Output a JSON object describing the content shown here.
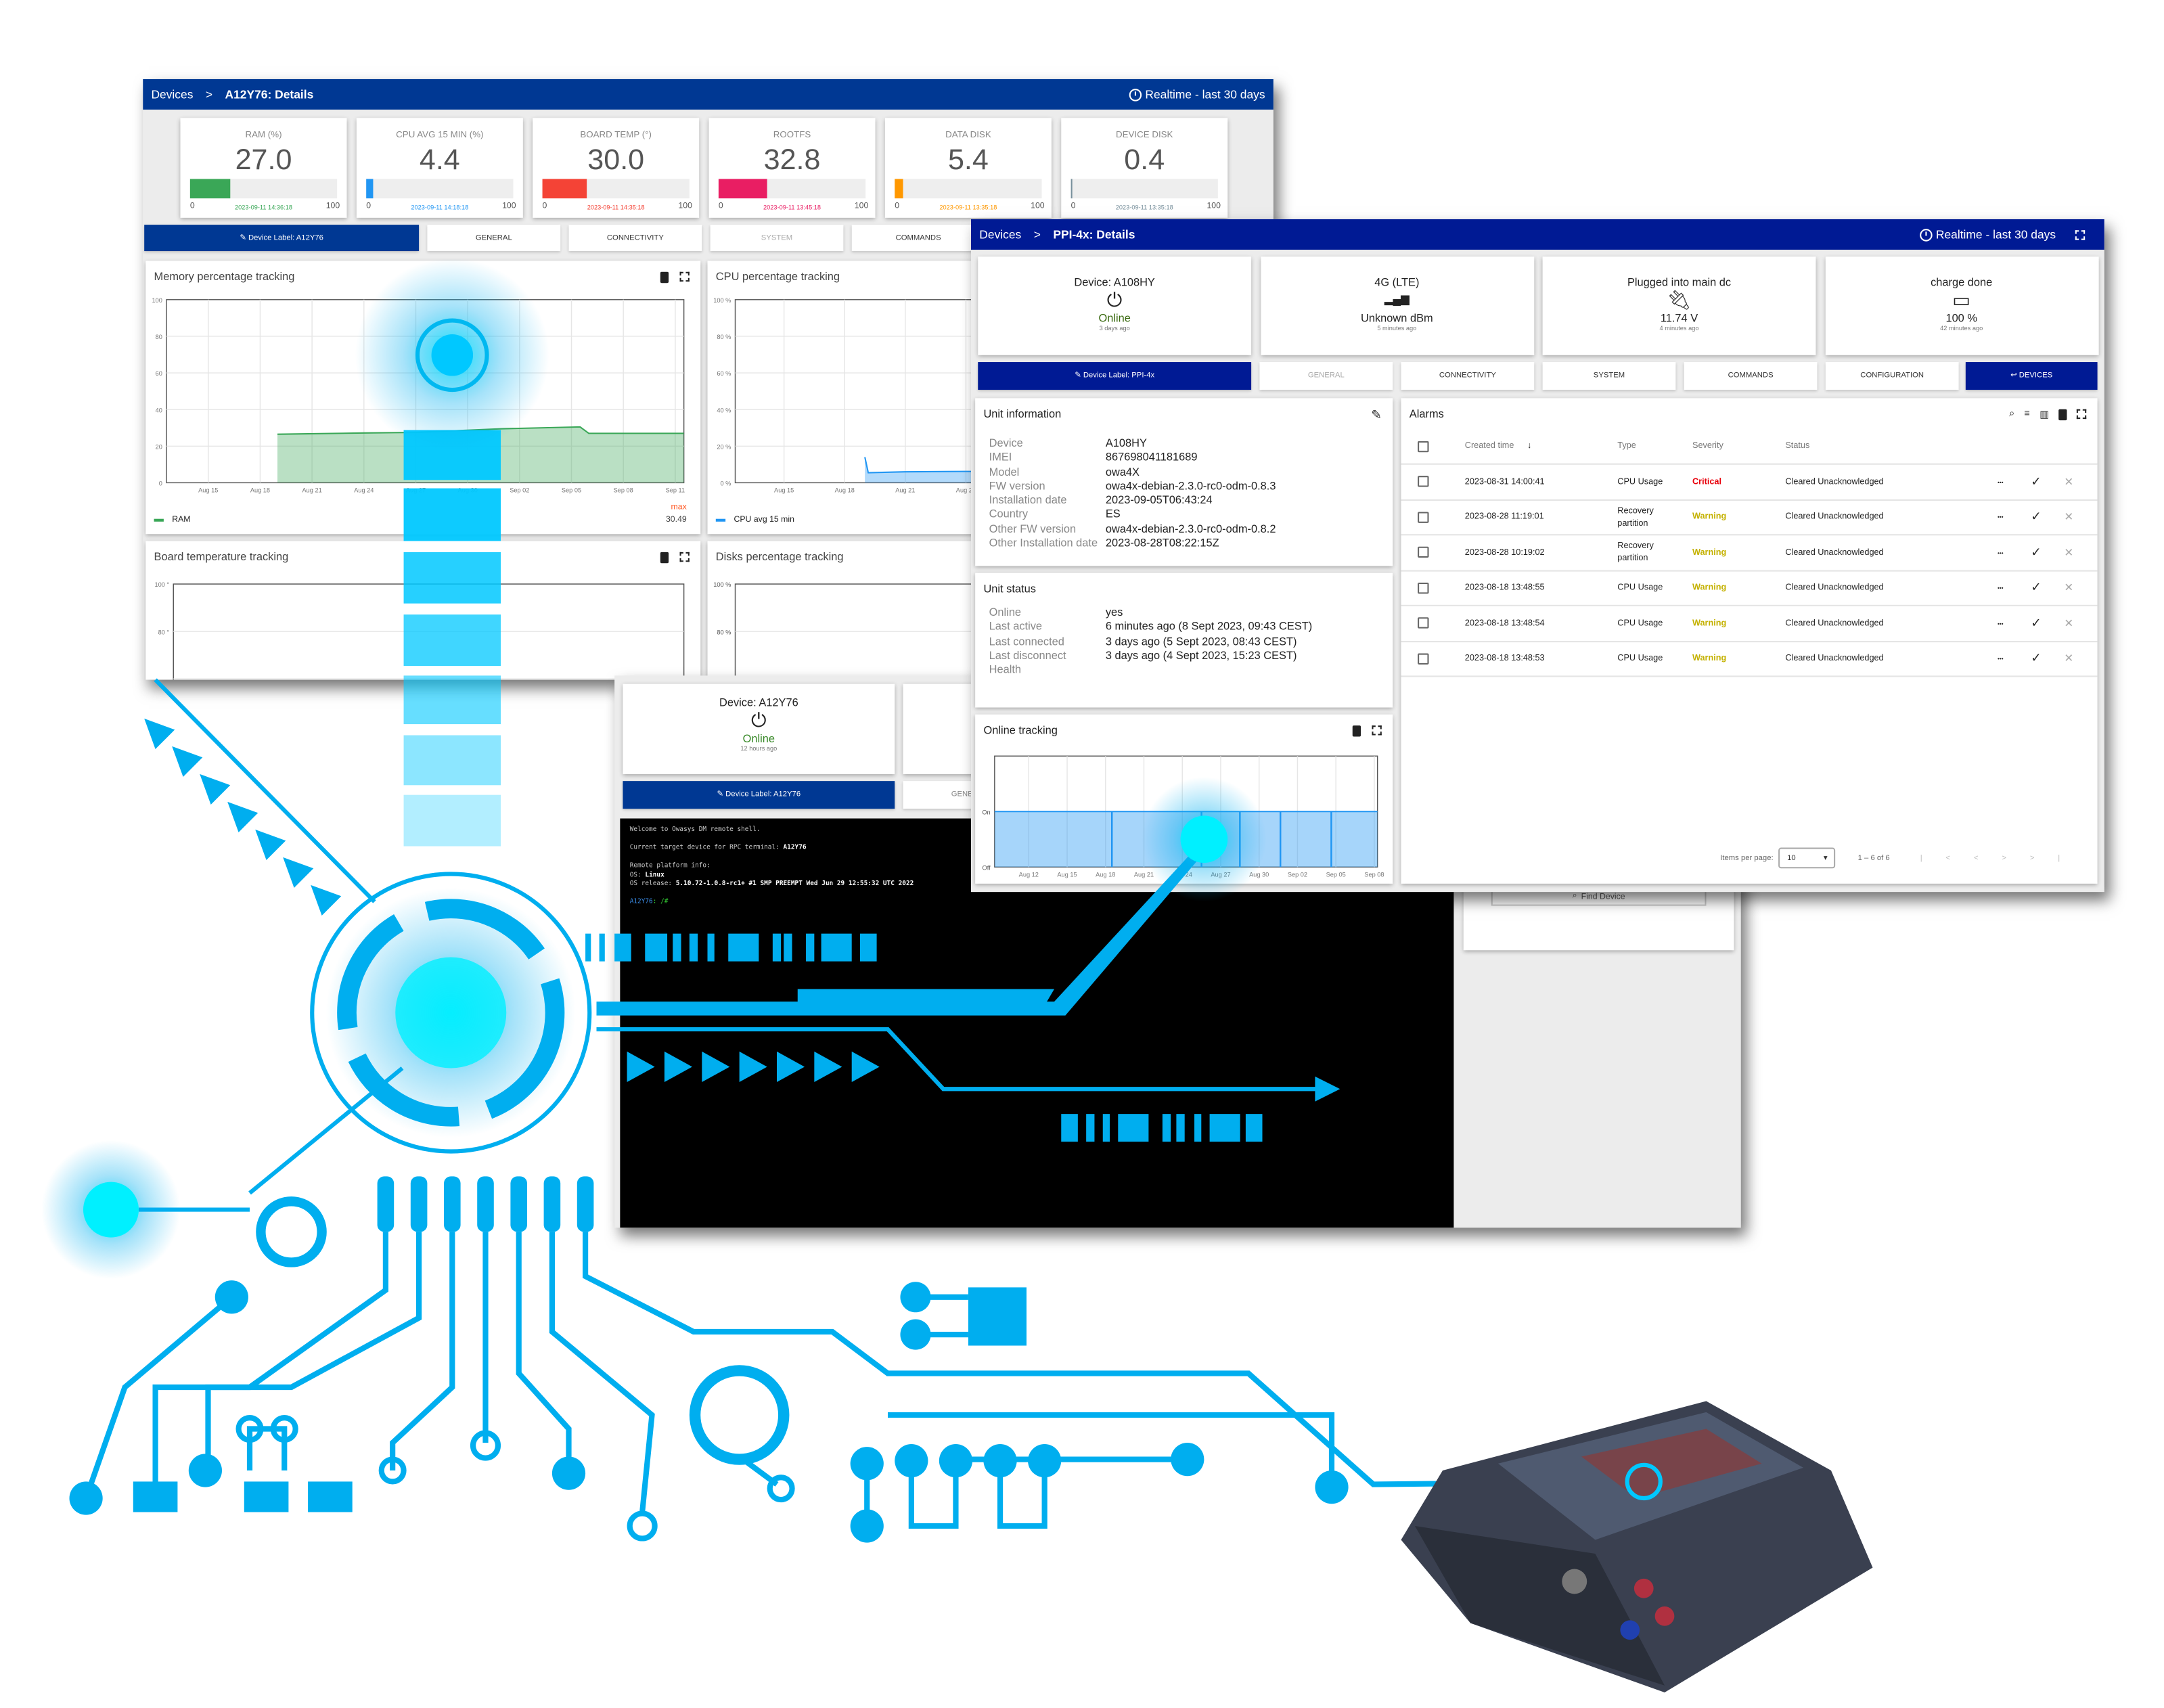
{
  "back_window": {
    "breadcrumb_root": "Devices",
    "separator": ">",
    "title": "A12Y76: Details",
    "realtime": "Realtime - last 30 days",
    "kpis": [
      {
        "label": "RAM (%)",
        "value": "27.0",
        "min": "0",
        "max": "100",
        "timestamp": "2023-09-11 14:36:18",
        "color": "#3aa757",
        "percent": 27
      },
      {
        "label": "CPU AVG 15 MIN (%)",
        "value": "4.4",
        "min": "0",
        "max": "100",
        "timestamp": "2023-09-11 14:18:18",
        "color": "#2196f3",
        "percent": 4.4
      },
      {
        "label": "BOARD TEMP (°)",
        "value": "30.0",
        "min": "0",
        "max": "100",
        "timestamp": "2023-09-11 14:35:18",
        "color": "#f44336",
        "percent": 30
      },
      {
        "label": "ROOTFS",
        "value": "32.8",
        "min": "0",
        "max": "100",
        "timestamp": "2023-09-11 13:45:18",
        "color": "#e91e63",
        "percent": 32.8
      },
      {
        "label": "DATA DISK",
        "value": "5.4",
        "min": "0",
        "max": "100",
        "timestamp": "2023-09-11 13:35:18",
        "color": "#ff9800",
        "percent": 5.4
      },
      {
        "label": "DEVICE DISK",
        "value": "0.4",
        "min": "0",
        "max": "100",
        "timestamp": "2023-09-11 13:35:18",
        "color": "#78909c",
        "percent": 0.4
      }
    ],
    "tabs": {
      "device_label": "Device Label: A12Y76",
      "general": "GENERAL",
      "connectivity": "CONNECTIVITY",
      "system": "SYSTEM",
      "commands": "COMMANDS"
    },
    "memory_chart": {
      "title": "Memory percentage tracking",
      "yticks": [
        "0",
        "20",
        "40",
        "60",
        "80",
        "100"
      ],
      "xticks": [
        "Aug 15",
        "Aug 18",
        "Aug 21",
        "Aug 24",
        "Aug 27",
        "Aug 30",
        "Sep 02",
        "Sep 05",
        "Sep 08",
        "Sep 11"
      ],
      "xlim": [
        "2023-08-12T14:00",
        "2023-09-11T12:00"
      ],
      "ylim": [
        0,
        100
      ],
      "color": "#3aa757",
      "series": [
        [
          "2023-08-19T00:00",
          26.5
        ],
        [
          "2023-08-24T00:00",
          27.2
        ],
        [
          "2023-08-27T00:00",
          27.5
        ],
        [
          "2023-09-01T00:00",
          29.5
        ],
        [
          "2023-09-05T12:00",
          30.5
        ],
        [
          "2023-09-06T00:00",
          27
        ],
        [
          "2023-09-11T12:00",
          27
        ]
      ],
      "legend": "RAM",
      "max_label": "max",
      "max_value": "30.49"
    },
    "cpu_chart": {
      "title": "CPU percentage tracking",
      "yticks": [
        "0 %",
        "20 %",
        "40 %",
        "60 %",
        "80 %",
        "100 %"
      ],
      "xticks": [
        "Aug 15",
        "Aug 18",
        "Aug 21",
        "Aug 24",
        "Aug 27"
      ],
      "xlim": [
        "2023-08-12T14:00",
        "2023-08-27T00:00"
      ],
      "ylim": [
        0,
        100
      ],
      "color": "#2196f3",
      "series": [
        [
          "2023-08-19T00:00",
          14
        ],
        [
          "2023-08-19T04:00",
          5.5
        ],
        [
          "2023-08-21T00:00",
          6
        ],
        [
          "2023-08-24T00:00",
          6.2
        ],
        [
          "2023-08-27T00:00",
          6
        ]
      ],
      "legend": "CPU avg 15 min"
    },
    "temp_chart": {
      "title": "Board temperature tracking",
      "yticks": [
        "80 °",
        "100 °"
      ]
    },
    "disks_chart": {
      "title": "Disks percentage tracking",
      "yticks": [
        "80 %",
        "100 %"
      ]
    }
  },
  "middle_window": {
    "device_card": {
      "title": "Device: A12Y76",
      "status": "Online",
      "since": "12 hours ago"
    },
    "tabs": {
      "device_label": "Device Label: A12Y76",
      "general": "GENERAL"
    },
    "terminal": {
      "welcome": "Welcome to Owasys DM remote shell.",
      "target_label": "Current target device for RPC terminal: ",
      "target": "A12Y76",
      "platform_label": "Remote platform info:",
      "os_label": "OS: ",
      "os": "Linux",
      "release_label": "OS release: ",
      "release": "5.10.72-1.0.8-rc1+ #1 SMP PREEMPT Wed Jun 29 12:55:32 UTC 2022",
      "prompt_host": "A12Y76",
      "prompt_path": ": /#"
    },
    "find_device": "Find Device"
  },
  "front_window": {
    "breadcrumb_root": "Devices",
    "separator": ">",
    "title": "PPI-4x: Details",
    "realtime": "Realtime - last 30 days",
    "status_cards": [
      {
        "title": "Device: A108HY",
        "icon": "power-icon",
        "value": "Online",
        "since": "3 days ago"
      },
      {
        "title": "4G (LTE)",
        "icon": "signal-icon",
        "value": "Unknown dBm",
        "since": "5 minutes ago"
      },
      {
        "title": "Plugged into main dc",
        "icon": "plug-icon",
        "value": "11.74 V",
        "since": "4 minutes ago"
      },
      {
        "title": "charge done",
        "icon": "battery-icon",
        "value": "100 %",
        "since": "42 minutes ago"
      }
    ],
    "tabs": {
      "device_label": "Device Label: PPI-4x",
      "general": "GENERAL",
      "connectivity": "CONNECTIVITY",
      "system": "SYSTEM",
      "commands": "COMMANDS",
      "configuration": "CONFIGURATION",
      "devices": "DEVICES"
    },
    "unit_information": {
      "title": "Unit information",
      "rows": [
        {
          "k": "Device",
          "v": "A108HY"
        },
        {
          "k": "IMEI",
          "v": "867698041181689"
        },
        {
          "k": "Model",
          "v": "owa4X"
        },
        {
          "k": "FW version",
          "v": "owa4x-debian-2.3.0-rc0-odm-0.8.3"
        },
        {
          "k": "Installation date",
          "v": "2023-09-05T06:43:24"
        },
        {
          "k": "Country",
          "v": "ES"
        },
        {
          "k": "Other FW version",
          "v": "owa4x-debian-2.3.0-rc0-odm-0.8.2"
        },
        {
          "k": "Other Installation date",
          "v": "2023-08-28T08:22:15Z"
        }
      ]
    },
    "unit_status": {
      "title": "Unit status",
      "rows": [
        {
          "k": "Online",
          "v": "yes"
        },
        {
          "k": "Last active",
          "v": "6 minutes ago (8 Sept 2023, 09:43 CEST)"
        },
        {
          "k": "Last connected",
          "v": "3 days ago (5 Sept 2023, 08:43 CEST)"
        },
        {
          "k": "Last disconnect",
          "v": "3 days ago (4 Sept 2023, 15:23 CEST)"
        },
        {
          "k": "Health",
          "v": ""
        }
      ]
    },
    "online_chart": {
      "title": "Online tracking",
      "yticks": [
        "Off",
        "On"
      ],
      "xticks": [
        "Aug 12",
        "Aug 15",
        "Aug 18",
        "Aug 21",
        "Aug 24",
        "Aug 27",
        "Aug 30",
        "Sep 02",
        "Sep 05",
        "Sep 08"
      ],
      "xlim": [
        "2023-08-09T08:00",
        "2023-09-08T06:00"
      ],
      "disconnects": [
        "2023-08-18T12:00",
        "2023-08-25T12:00",
        "2023-08-28T12:00",
        "2023-08-31T16:00",
        "2023-09-04T15:23"
      ],
      "color": "#2196f3"
    },
    "alarms": {
      "title": "Alarms",
      "columns": [
        "Created time",
        "Type",
        "Severity",
        "Status"
      ],
      "rows": [
        {
          "time": "2023-08-31 14:00:41",
          "type": "CPU Usage",
          "severity": "Critical",
          "status": "Cleared Unacknowledged"
        },
        {
          "time": "2023-08-28 11:19:01",
          "type": "Recovery partition",
          "severity": "Warning",
          "status": "Cleared Unacknowledged"
        },
        {
          "time": "2023-08-28 10:19:02",
          "type": "Recovery partition",
          "severity": "Warning",
          "status": "Cleared Unacknowledged"
        },
        {
          "time": "2023-08-18 13:48:55",
          "type": "CPU Usage",
          "severity": "Warning",
          "status": "Cleared Unacknowledged"
        },
        {
          "time": "2023-08-18 13:48:54",
          "type": "CPU Usage",
          "severity": "Warning",
          "status": "Cleared Unacknowledged"
        },
        {
          "time": "2023-08-18 13:48:53",
          "type": "CPU Usage",
          "severity": "Warning",
          "status": "Cleared Unacknowledged"
        }
      ],
      "severity_colors": {
        "Critical": "#e8000b",
        "Warning": "#c4b100"
      },
      "items_per_page_label": "Items per page:",
      "items_per_page": "10",
      "range": "1 – 6 of 6"
    }
  },
  "colors": {
    "back_header": "#003893",
    "front_header": "#001a94",
    "accent_cyan": "#00c8ff"
  }
}
